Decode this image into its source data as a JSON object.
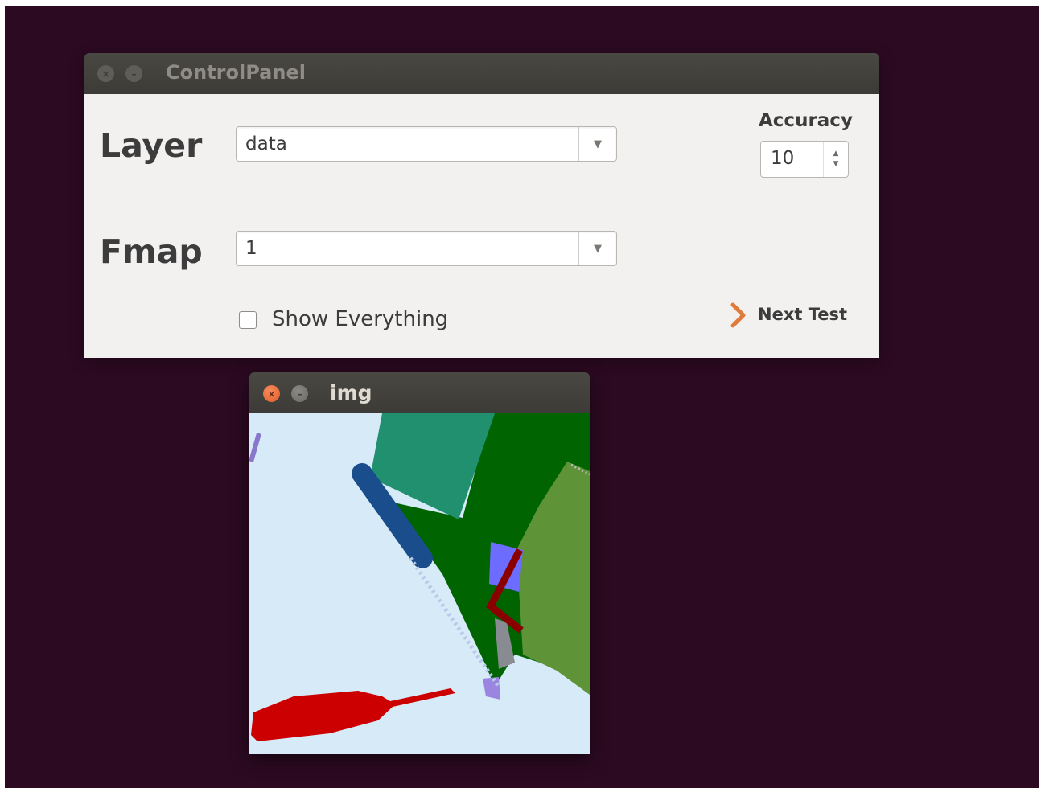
{
  "control_panel": {
    "title": "ControlPanel",
    "layer_label": "Layer",
    "layer_value": "data",
    "fmap_label": "Fmap",
    "fmap_value": "1",
    "accuracy_label": "Accuracy",
    "accuracy_value": "10",
    "show_everything_label": "Show Everything",
    "show_everything_checked": false,
    "next_test_label": "Next Test"
  },
  "img_window": {
    "title": "img"
  },
  "colors": {
    "desktop_bg": "#2c0a22",
    "titlebar": "#3c3b37",
    "close_button_active": "#e05a25",
    "next_arrow": "#e07b39",
    "segment_background": "#d6eaf8"
  }
}
